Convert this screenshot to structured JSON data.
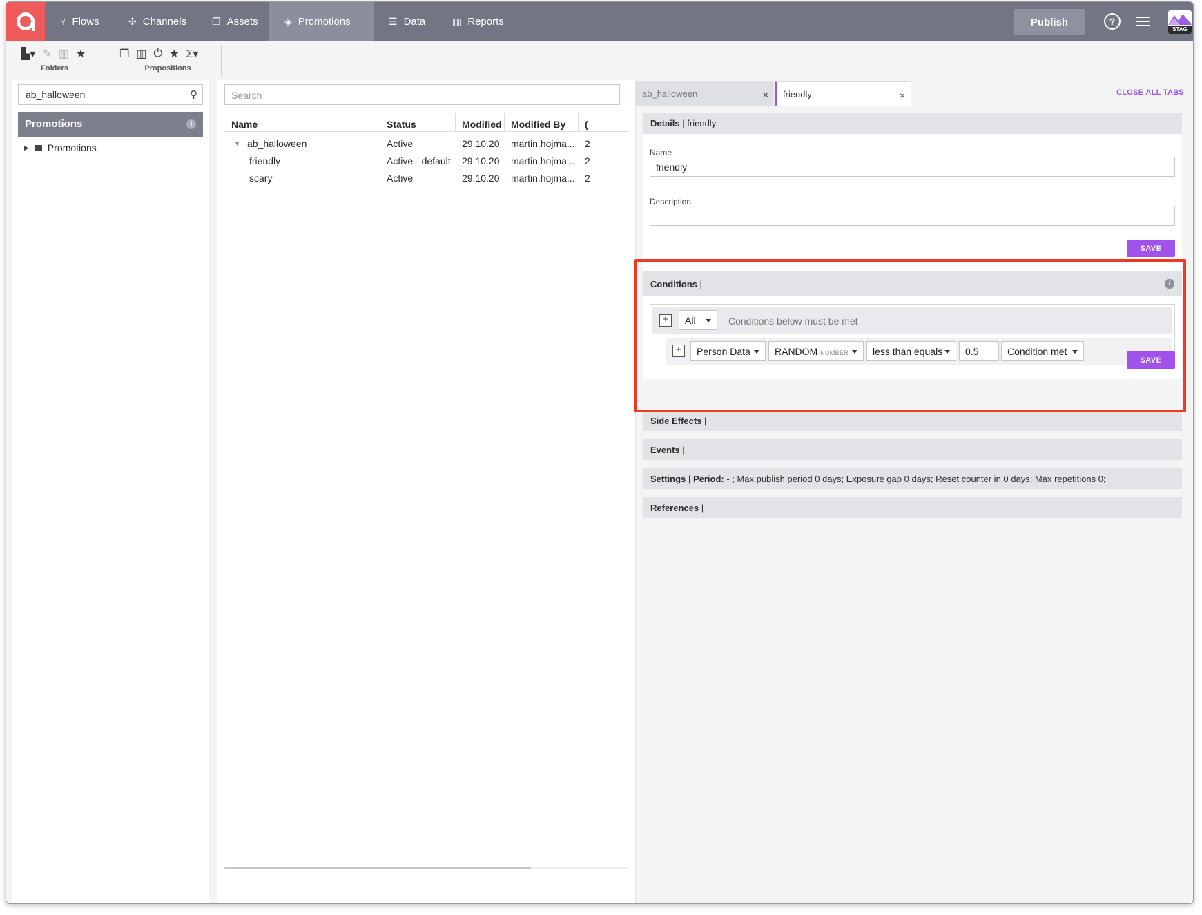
{
  "nav": {
    "items": [
      {
        "label": "Flows",
        "icon": "flows-icon"
      },
      {
        "label": "Channels",
        "icon": "channels-icon"
      },
      {
        "label": "Assets",
        "icon": "assets-icon"
      },
      {
        "label": "Promotions",
        "icon": "promotions-icon",
        "active": true
      },
      {
        "label": "Data",
        "icon": "data-icon"
      },
      {
        "label": "Reports",
        "icon": "reports-icon"
      }
    ],
    "publish_label": "Publish",
    "help_glyph": "?",
    "env_badge": "STAG"
  },
  "toolbar": {
    "folders_label": "Folders",
    "propositions_label": "Propositions"
  },
  "left": {
    "search_value": "ab_halloween",
    "tree_header": "Promotions",
    "tree_node": "Promotions"
  },
  "middle": {
    "search_placeholder": "Search",
    "columns": [
      "Name",
      "Status",
      "Modified",
      "Modified By"
    ],
    "rows": [
      {
        "name": "ab_halloween",
        "status": "Active",
        "modified": "29.10.20",
        "modified_by": "martin.hojma...",
        "extra": "2"
      },
      {
        "name": "friendly",
        "status": "Active - default",
        "modified": "29.10.20",
        "modified_by": "martin.hojma...",
        "extra": "2"
      },
      {
        "name": "scary",
        "status": "Active",
        "modified": "29.10.20",
        "modified_by": "martin.hojma...",
        "extra": "2"
      }
    ]
  },
  "right": {
    "tabs": [
      {
        "label": "ab_halloween",
        "close": "×"
      },
      {
        "label": "friendly",
        "close": "×"
      }
    ],
    "close_all_label": "CLOSE ALL TABS",
    "details": {
      "title": "Details",
      "sep": "|",
      "subtitle": "friendly",
      "name_label": "Name",
      "name_value": "friendly",
      "description_label": "Description",
      "description_value": "",
      "save_label": "SAVE"
    },
    "conditions": {
      "title": "Conditions",
      "sep": "|",
      "group_operator": "All",
      "hint": "Conditions below must be met",
      "rule": {
        "source": "Person Data",
        "attribute": "RANDOM",
        "attribute_type": "NUMBER",
        "operator": "less than equals",
        "value": "0.5",
        "result": "Condition met"
      },
      "save_label": "SAVE"
    },
    "side_effects": {
      "title": "Side Effects",
      "sep": "|"
    },
    "events": {
      "title": "Events",
      "sep": "|"
    },
    "settings": {
      "title": "Settings",
      "sep": "|",
      "period_label": "Period:",
      "summary": "- ; Max publish period 0 days; Exposure gap 0 days; Reset counter in 0 days; Max repetitions 0;"
    },
    "references": {
      "title": "References",
      "sep": "|"
    }
  },
  "colors": {
    "nav_bg": "#737585",
    "logo_bg": "#ef5b5b",
    "accent": "#a052ea",
    "highlight": "#ec3b24"
  }
}
